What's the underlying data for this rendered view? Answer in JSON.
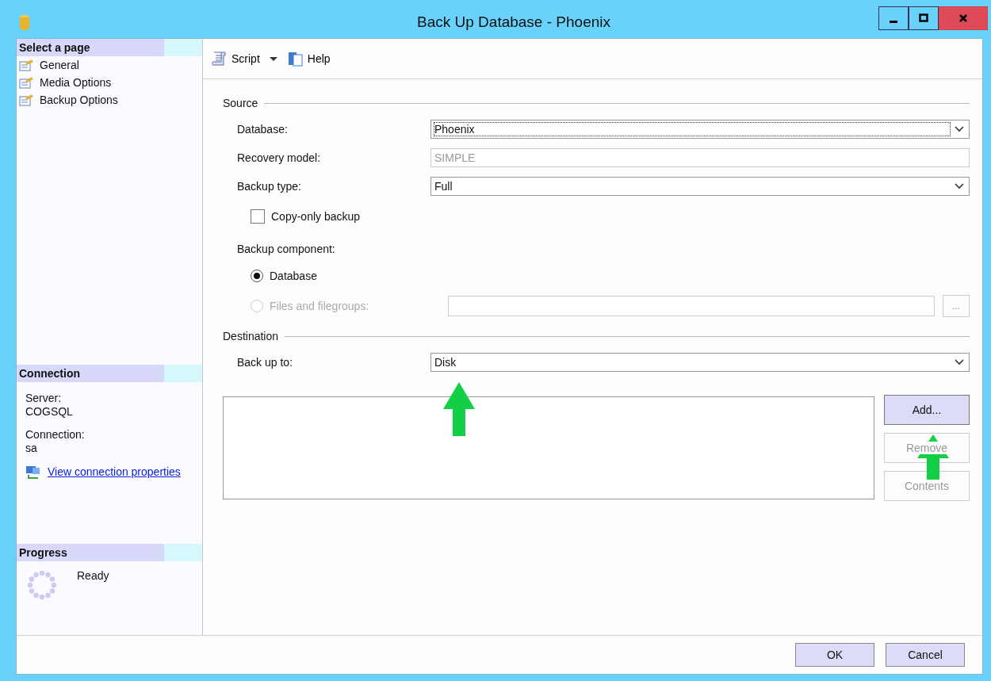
{
  "window": {
    "title": "Back Up Database - Phoenix"
  },
  "sidebar": {
    "heading": "Select a page",
    "pages": [
      {
        "label": "General"
      },
      {
        "label": "Media Options"
      },
      {
        "label": "Backup Options"
      }
    ]
  },
  "connection": {
    "heading": "Connection",
    "fields": [
      {
        "label": "Server:",
        "value": "COGSQL"
      },
      {
        "label": "Connection:",
        "value": "sa"
      }
    ],
    "link": "View connection properties"
  },
  "progress": {
    "heading": "Progress",
    "status": "Ready"
  },
  "toolbar": [
    {
      "label": "Script",
      "kind": "script"
    },
    {
      "label": "Help",
      "kind": "help"
    }
  ],
  "source": {
    "heading": "Source",
    "fields": [
      {
        "label": "Database:",
        "value": "Phoenix",
        "kind": "combo",
        "disabled": false,
        "focused": true
      },
      {
        "label": "Recovery model:",
        "value": "SIMPLE",
        "kind": "text",
        "disabled": true,
        "focused": false
      },
      {
        "label": "Backup type:",
        "value": "Full",
        "kind": "combo",
        "disabled": false,
        "focused": false
      }
    ],
    "copy_only": {
      "label": "Copy-only backup",
      "checked": false
    },
    "component_label": "Backup component:",
    "components": [
      {
        "label": "Database",
        "selected": true,
        "disabled": false
      },
      {
        "label": "Files and filegroups:",
        "selected": false,
        "disabled": true
      }
    ],
    "browse_button": "..."
  },
  "destination": {
    "heading": "Destination",
    "label": "Back up to:",
    "value": "Disk",
    "buttons": [
      {
        "label": "Add...",
        "disabled": false
      },
      {
        "label": "Remove",
        "disabled": true
      },
      {
        "label": "Contents",
        "disabled": true
      }
    ]
  },
  "footer": [
    {
      "label": "OK"
    },
    {
      "label": "Cancel"
    }
  ]
}
